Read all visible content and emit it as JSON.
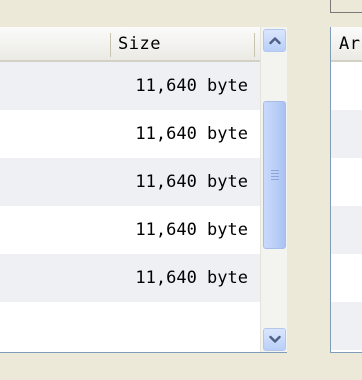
{
  "left_list": {
    "header": {
      "size_label": "Size"
    },
    "rows": [
      {
        "size": "11,640 byte"
      },
      {
        "size": "11,640 byte"
      },
      {
        "size": "11,640 byte"
      },
      {
        "size": "11,640 byte"
      },
      {
        "size": "11,640 byte"
      }
    ]
  },
  "right_list": {
    "header": {
      "label": "Ar"
    }
  },
  "scrollbar": {
    "up_icon": "chevron-up-icon",
    "down_icon": "chevron-down-icon",
    "position_fraction": 0.3,
    "visible_fraction": 0.55
  },
  "colors": {
    "row_alt": "#EEF0F4",
    "scroll_button": "#C1D3FB",
    "border": "#7F9DB9",
    "window_bg": "#ECE9D8"
  }
}
